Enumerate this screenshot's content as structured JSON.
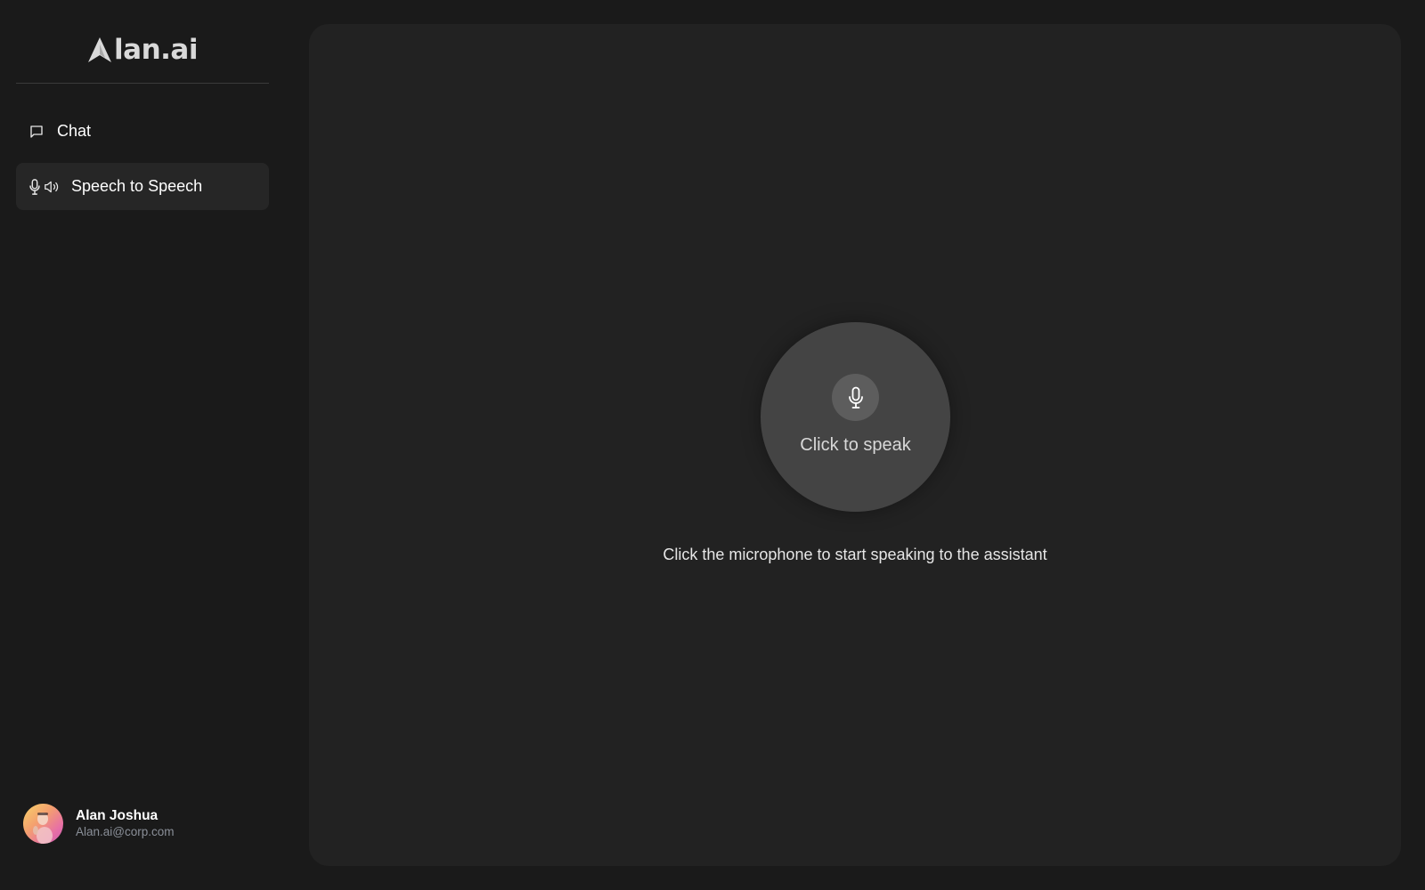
{
  "brand": {
    "logo_text": "lan.ai",
    "logo_full": "Alan.ai"
  },
  "sidebar": {
    "items": [
      {
        "label": "Chat",
        "icon": "chat-bubble-icon",
        "active": false
      },
      {
        "label": "Speech to Speech",
        "icon": "microphone-speaker-icon",
        "active": true
      }
    ]
  },
  "user": {
    "name": "Alan Joshua",
    "email": "Alan.ai@corp.com"
  },
  "speech": {
    "button_label": "Click to speak",
    "hint": "Click the microphone to start speaking to the assistant",
    "icon": "microphone-icon"
  },
  "colors": {
    "background": "#1a1a1a",
    "panel": "#222222",
    "active_nav": "#262626",
    "speak_circle": "#444444",
    "mic_button": "#5d5d5d",
    "email_text": "#8a8f98"
  }
}
